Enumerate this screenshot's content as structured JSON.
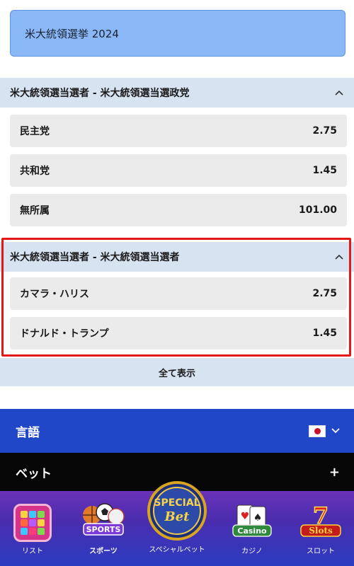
{
  "title": "米大統領選挙 2024",
  "sections": [
    {
      "header": "米大統領選当選者 - 米大統領選当選政党",
      "rows": [
        {
          "name": "民主党",
          "odds": "2.75"
        },
        {
          "name": "共和党",
          "odds": "1.45"
        },
        {
          "name": "無所属",
          "odds": "101.00"
        }
      ]
    },
    {
      "header": "米大統領選当選者 - 米大統領選当選者",
      "rows": [
        {
          "name": "カマラ・ハリス",
          "odds": "2.75"
        },
        {
          "name": "ドナルド・トランプ",
          "odds": "1.45"
        }
      ]
    }
  ],
  "show_all_label": "全て表示",
  "language": {
    "label": "言語",
    "flag_icon": "japan-flag-icon"
  },
  "bet": {
    "label": "ベット",
    "expand_icon": "plus-icon"
  },
  "bottom_nav": [
    {
      "label": "リスト",
      "icon": "slot-grid-icon"
    },
    {
      "label": "スポーツ",
      "icon": "sports-balls-icon",
      "active": true
    },
    {
      "label": "スペシャルベット",
      "icon": "special-bet-icon",
      "badge_top": "SPECIAL",
      "badge_bottom": "Bet"
    },
    {
      "label": "カジノ",
      "icon": "casino-icon",
      "badge_text": "Casino"
    },
    {
      "label": "スロット",
      "icon": "slots-icon",
      "badge_text": "Slots"
    }
  ],
  "colors": {
    "title_bg": "#8ab8f6",
    "section_bg": "#d7e3f1",
    "row_bg": "#ebebeb",
    "highlight": "#e01818",
    "language_bar": "#2147c9",
    "bet_bar": "#060606"
  }
}
